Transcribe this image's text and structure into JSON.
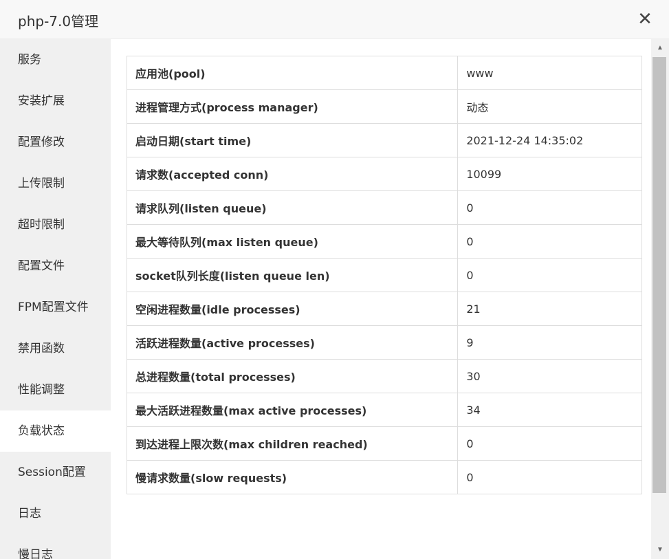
{
  "window": {
    "title": "php-7.0管理",
    "close_icon": "close-icon"
  },
  "sidebar": {
    "items": [
      {
        "label": "服务"
      },
      {
        "label": "安装扩展"
      },
      {
        "label": "配置修改"
      },
      {
        "label": "上传限制"
      },
      {
        "label": "超时限制"
      },
      {
        "label": "配置文件"
      },
      {
        "label": "FPM配置文件"
      },
      {
        "label": "禁用函数"
      },
      {
        "label": "性能调整"
      },
      {
        "label": "负载状态",
        "active": true
      },
      {
        "label": "Session配置"
      },
      {
        "label": "日志"
      },
      {
        "label": "慢日志"
      }
    ]
  },
  "status_table": {
    "rows": [
      {
        "key": "应用池(pool)",
        "value": "www"
      },
      {
        "key": "进程管理方式(process manager)",
        "value": "动态"
      },
      {
        "key": "启动日期(start time)",
        "value": "2021-12-24 14:35:02"
      },
      {
        "key": "请求数(accepted conn)",
        "value": "10099"
      },
      {
        "key": "请求队列(listen queue)",
        "value": "0"
      },
      {
        "key": "最大等待队列(max listen queue)",
        "value": "0"
      },
      {
        "key": "socket队列长度(listen queue len)",
        "value": "0"
      },
      {
        "key": "空闲进程数量(idle processes)",
        "value": "21"
      },
      {
        "key": "活跃进程数量(active processes)",
        "value": "9"
      },
      {
        "key": "总进程数量(total processes)",
        "value": "30"
      },
      {
        "key": "最大活跃进程数量(max active processes)",
        "value": "34"
      },
      {
        "key": "到达进程上限次数(max children reached)",
        "value": "0"
      },
      {
        "key": "慢请求数量(slow requests)",
        "value": "0"
      }
    ]
  },
  "scrollbar": {
    "up_arrow": "▲",
    "down_arrow": "▼"
  }
}
